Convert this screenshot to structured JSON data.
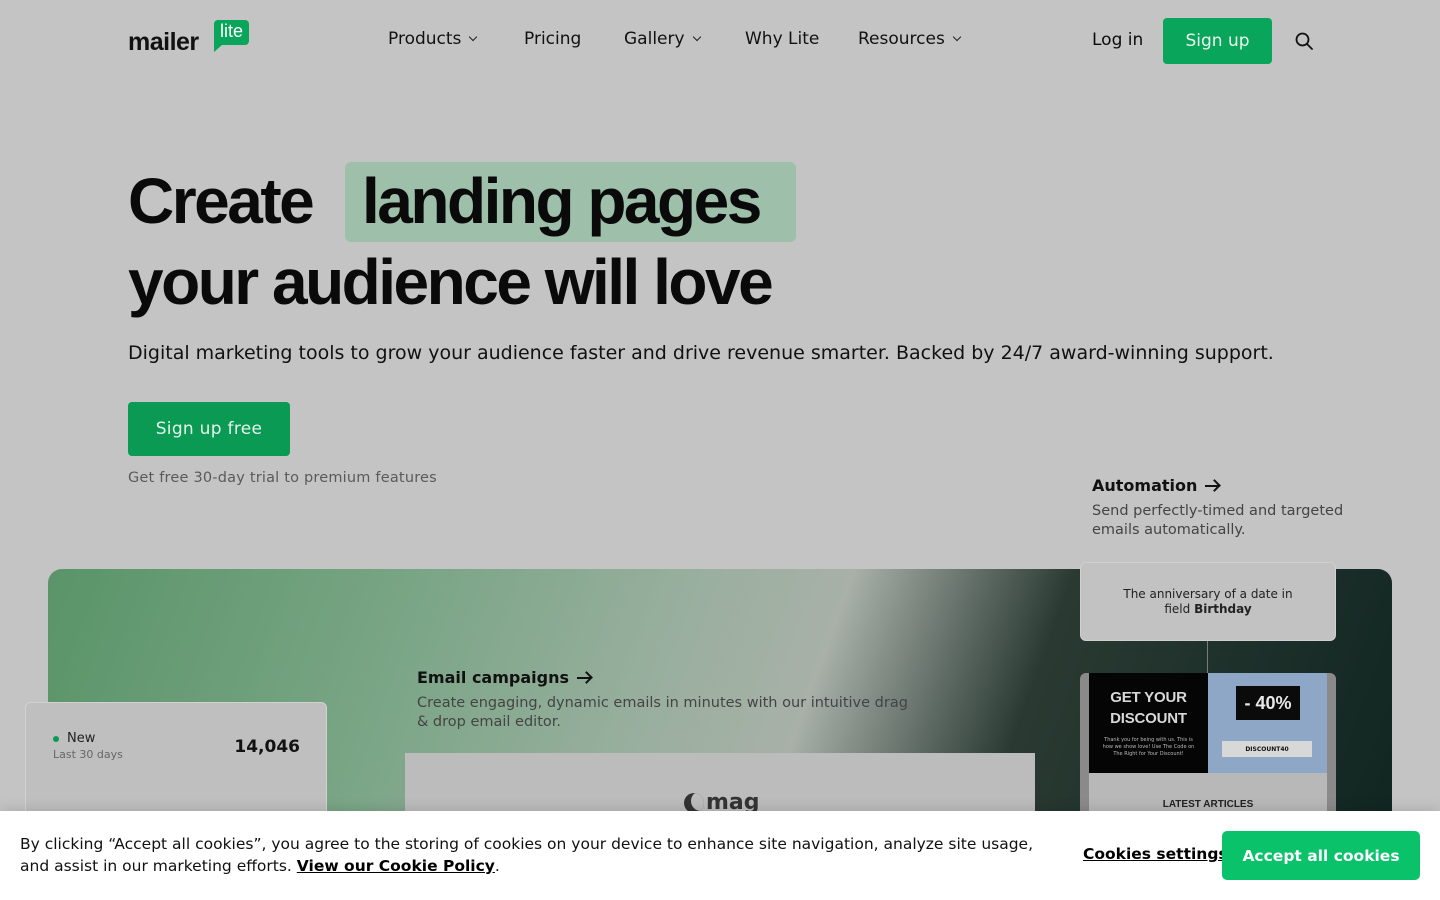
{
  "brand": {
    "logo_word": "mailer",
    "logo_badge": "lite",
    "accent": "#09a55a"
  },
  "nav": {
    "items": [
      {
        "label": "Products",
        "has_dropdown": true
      },
      {
        "label": "Pricing",
        "has_dropdown": false
      },
      {
        "label": "Gallery",
        "has_dropdown": true
      },
      {
        "label": "Why Lite",
        "has_dropdown": false
      },
      {
        "label": "Resources",
        "has_dropdown": true
      }
    ],
    "login": "Log in",
    "signup": "Sign up",
    "search_icon": "search-icon"
  },
  "hero": {
    "line1_start": "Create",
    "line1_highlight": "landing pages",
    "line2": "your audience will love",
    "subtitle": "Digital marketing tools to grow your audience faster and drive revenue smarter. Backed by 24/7 award-winning support.",
    "cta": "Sign up free",
    "trial_note": "Get free 30-day trial to premium features"
  },
  "features": {
    "automation": {
      "title": "Automation",
      "desc_line1": "Send perfectly-timed and targeted",
      "desc_line2": "emails automatically."
    },
    "email_campaigns": {
      "title": "Email campaigns",
      "desc_line1": "Create engaging, dynamic emails in minutes with our intuitive drag",
      "desc_line2": "& drop email editor."
    }
  },
  "showcase": {
    "stat": {
      "label": "New",
      "sublabel": "Last 30 days",
      "value": "14,046"
    },
    "email_preview_logo": "mag",
    "automation_trigger": {
      "text": "The anniversary of a date in",
      "text2_prefix": "field",
      "field": "Birthday"
    },
    "promo": {
      "headline_1": "GET YOUR",
      "headline_2": "DISCOUNT",
      "small_text": "Thank you for being with us. This is how we show love! Use The Code on The Right for Your Discount!",
      "percent": "- 40%",
      "code": "DISCOUNT40",
      "articles": "LATEST ARTICLES"
    }
  },
  "cookie": {
    "text": "By clicking “Accept all cookies”, you agree to the storing of cookies on your device to enhance site navigation, analyze site usage, and assist in our marketing efforts.",
    "policy_link": "View our Cookie Policy",
    "period": ".",
    "settings": "Cookies settings",
    "accept": "Accept all cookies"
  }
}
